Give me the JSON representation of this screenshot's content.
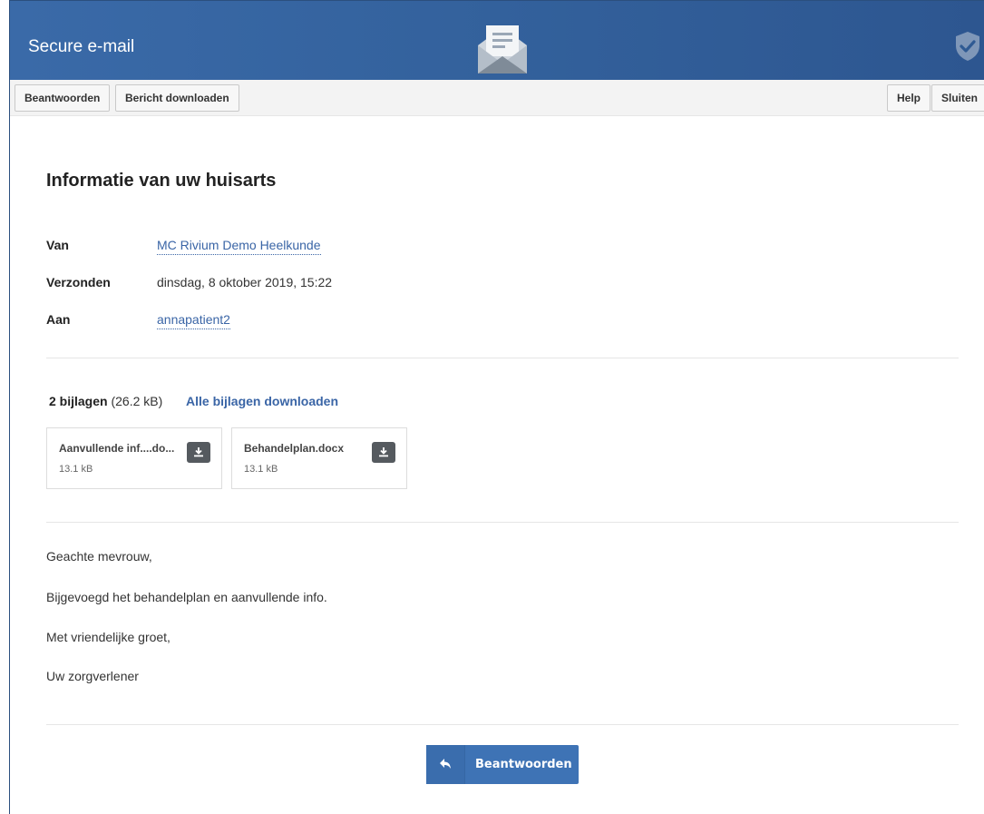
{
  "header": {
    "title": "Secure e-mail",
    "logo_icon": "envelope-open-icon",
    "shield_icon": "shield-check-icon",
    "color": "#3566a3"
  },
  "toolbar": {
    "reply_label": "Beantwoorden",
    "download_label": "Bericht downloaden",
    "help_label": "Help",
    "close_label": "Sluiten"
  },
  "message": {
    "subject": "Informatie van uw huisarts",
    "from_label": "Van",
    "from_value": "MC Rivium Demo Heelkunde",
    "sent_label": "Verzonden",
    "sent_value": "dinsdag, 8 oktober 2019, 15:22",
    "to_label": "Aan",
    "to_value": "annapatient2"
  },
  "attachments": {
    "count_label": "2 bijlagen",
    "total_size": "(26.2 kB)",
    "download_all_label": "Alle bijlagen downloaden",
    "items": [
      {
        "name": "Aanvullende inf....do...",
        "size": "13.1 kB",
        "icon": "download-icon"
      },
      {
        "name": "Behandelplan.docx",
        "size": "13.1 kB",
        "icon": "download-icon"
      }
    ]
  },
  "body": {
    "lines": [
      "Geachte mevrouw,",
      "Bijgevoegd het behandelplan en aanvullende info.",
      "Met vriendelijke groet,",
      "Uw zorgverlener"
    ]
  },
  "footer": {
    "reply_label": "Beantwoorden",
    "reply_icon": "reply-arrow-icon",
    "accent_color": "#3e73b5"
  }
}
